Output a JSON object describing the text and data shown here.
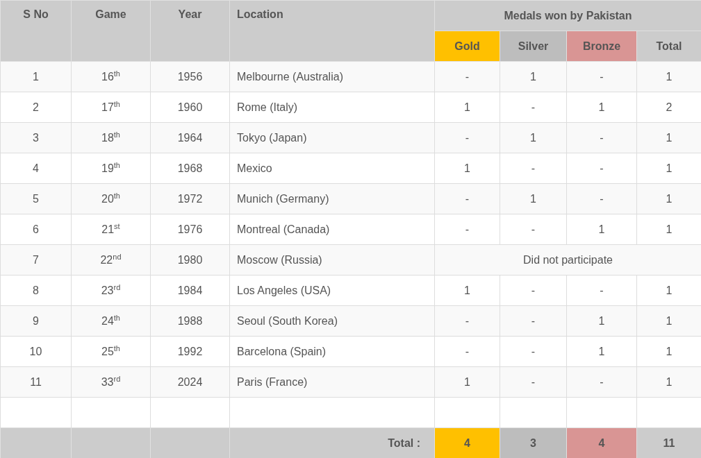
{
  "table": {
    "columns": [
      "S No",
      "Game",
      "Year",
      "Location"
    ],
    "group_header": "Medals won by Pakistan",
    "medal_columns": [
      {
        "label": "Gold",
        "kind": "gold"
      },
      {
        "label": "Silver",
        "kind": "silver"
      },
      {
        "label": "Bronze",
        "kind": "bronze"
      },
      {
        "label": "Total",
        "kind": "total"
      }
    ],
    "rows": [
      {
        "kind": "medals",
        "sno": "1",
        "game": "16$^{th}$",
        "year": "1956",
        "location": "Melbourne (Australia)",
        "medals": [
          "-",
          "1",
          "-",
          "1"
        ]
      },
      {
        "kind": "medals",
        "sno": "2",
        "game": "17$^{th}$",
        "year": "1960",
        "location": "Rome (Italy)",
        "medals": [
          "1",
          "-",
          "1",
          "2"
        ]
      },
      {
        "kind": "medals",
        "sno": "3",
        "game": "18$^{th}$",
        "year": "1964",
        "location": "Tokyo (Japan)",
        "medals": [
          "-",
          "1",
          "-",
          "1"
        ]
      },
      {
        "kind": "medals",
        "sno": "4",
        "game": "19$^{th}$",
        "year": "1968",
        "location": "Mexico",
        "medals": [
          "1",
          "-",
          "-",
          "1"
        ]
      },
      {
        "kind": "medals",
        "sno": "5",
        "game": "20$^{th}$",
        "year": "1972",
        "location": "Munich (Germany)",
        "medals": [
          "-",
          "1",
          "-",
          "1"
        ]
      },
      {
        "kind": "medals",
        "sno": "6",
        "game": "21$^{st}$",
        "year": "1976",
        "location": "Montreal (Canada)",
        "medals": [
          "-",
          "-",
          "1",
          "1"
        ]
      },
      {
        "kind": "note",
        "sno": "7",
        "game": "22$^{nd}$",
        "year": "1980",
        "location": "Moscow (Russia)",
        "note": "Did not participate"
      },
      {
        "kind": "medals",
        "sno": "8",
        "game": "23$^{rd}$",
        "year": "1984",
        "location": "Los Angeles (USA)",
        "medals": [
          "1",
          "-",
          "-",
          "1"
        ]
      },
      {
        "kind": "medals",
        "sno": "9",
        "game": "24$^{th}$",
        "year": "1988",
        "location": "Seoul (South Korea)",
        "medals": [
          "-",
          "-",
          "1",
          "1"
        ]
      },
      {
        "kind": "medals",
        "sno": "10",
        "game": "25$^{th}$",
        "year": "1992",
        "location": "Barcelona (Spain)",
        "medals": [
          "-",
          "-",
          "1",
          "1"
        ]
      },
      {
        "kind": "medals",
        "sno": "11",
        "game": "33$^{rd}$",
        "year": "2024",
        "location": "Paris (France)",
        "medals": [
          "1",
          "-",
          "-",
          "1"
        ]
      }
    ],
    "footer": {
      "label": "Total :",
      "medals": [
        "4",
        "3",
        "4",
        "11"
      ]
    }
  }
}
